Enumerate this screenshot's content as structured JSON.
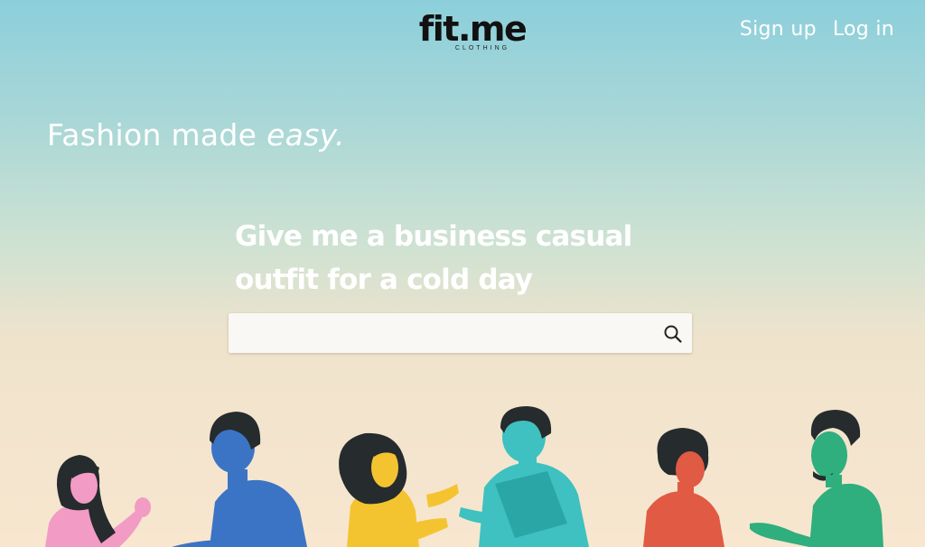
{
  "brand": {
    "name": "fit.me",
    "subtitle": "CLOTHING"
  },
  "nav": {
    "signup_label": "Sign up",
    "login_label": "Log in"
  },
  "hero": {
    "tagline_main": "Fashion made ",
    "tagline_emphasis": "easy."
  },
  "search": {
    "prompt": "Give me a business casual outfit for a cold day",
    "value": "",
    "icon": "search-icon"
  },
  "illustration": {
    "icon": "people-talking-illustration"
  },
  "colors": {
    "gradient_top": "#8ccfdb",
    "gradient_bottom": "#f8e6cf",
    "text_light": "#ffffff",
    "logo": "#111111",
    "search_bg": "#faf8f4"
  }
}
